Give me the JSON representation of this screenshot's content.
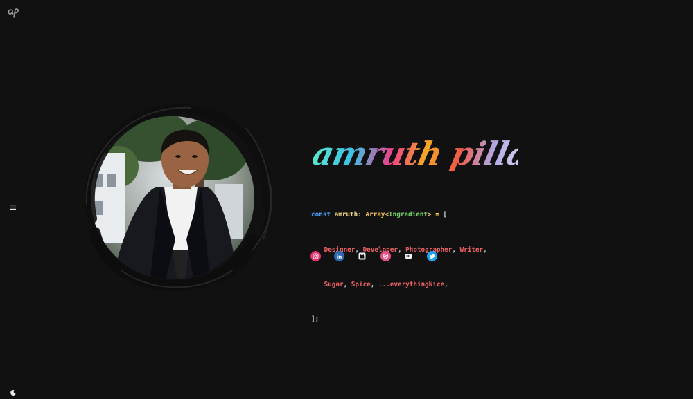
{
  "brand": {
    "logo_icon": "ap-monogram-icon"
  },
  "profile": {
    "name": "amruth pillai"
  },
  "code": {
    "line1": {
      "kw": "const",
      "id": "amruth",
      "colon": ":",
      "type": "Array",
      "lt": "<",
      "generic": "Ingredient",
      "gt": ">",
      "eq": " =",
      "open": " ["
    },
    "line2": [
      "Designer",
      "Developer",
      "Photographer",
      "Writer"
    ],
    "line3": [
      "Sugar",
      "Spice",
      "...everythingNice"
    ],
    "line4": "];"
  },
  "social": [
    {
      "name": "instagram-icon",
      "color": "#e1306c"
    },
    {
      "name": "linkedin-icon",
      "color": "#2867b2"
    },
    {
      "name": "github-icon",
      "color": "#ffffff"
    },
    {
      "name": "dribbble-icon",
      "color": "#ea4c89"
    },
    {
      "name": "devto-icon",
      "color": "#ffffff"
    },
    {
      "name": "twitter-icon",
      "color": "#1da1f2"
    }
  ],
  "colors": {
    "background": "#111112",
    "keyword": "#4d9bf0",
    "string": "#f06262",
    "type": "#75d06a"
  },
  "icons": {
    "menu": "hamburger-menu-icon",
    "theme": "moon-icon"
  }
}
